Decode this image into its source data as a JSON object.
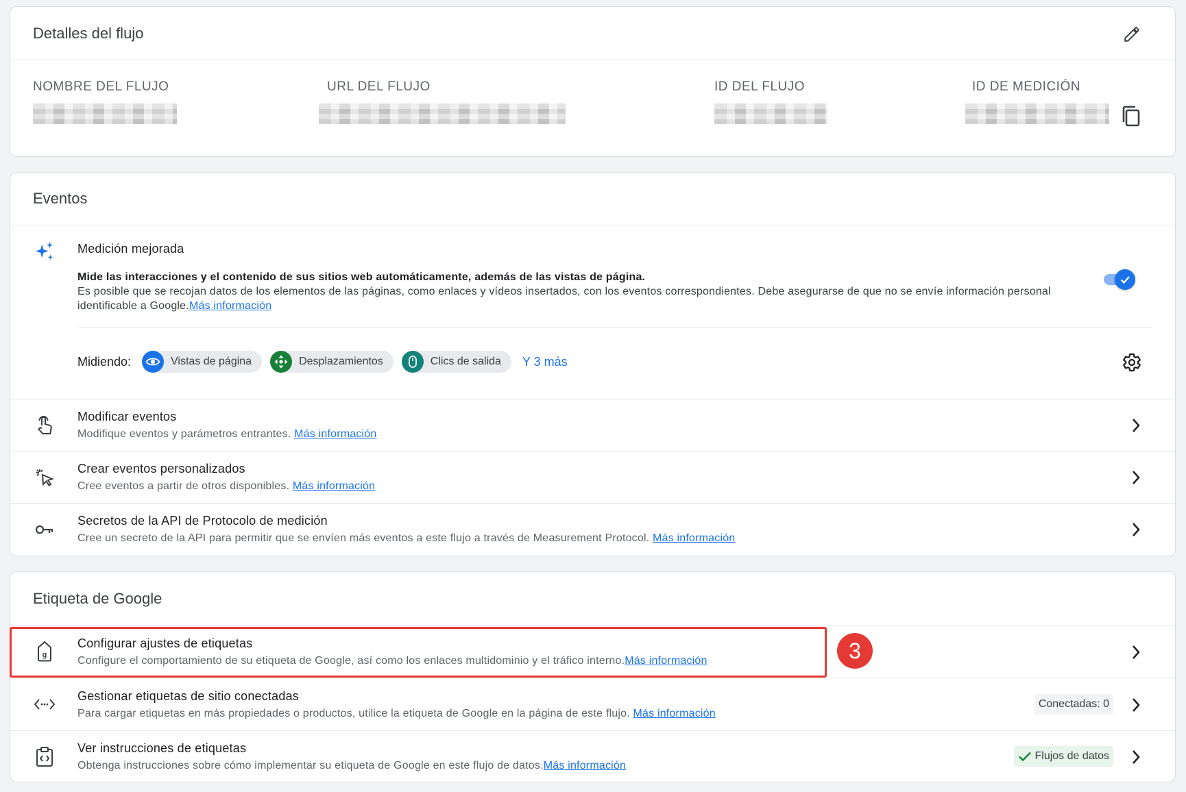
{
  "stream_details": {
    "title": "Detalles del flujo",
    "fields": [
      {
        "label": "NOMBRE DEL FLUJO"
      },
      {
        "label": "URL DEL FLUJO"
      },
      {
        "label": "ID DEL FLUJO"
      },
      {
        "label": "ID DE MEDICIÓN"
      }
    ]
  },
  "events": {
    "title": "Eventos",
    "enhanced": {
      "title": "Medición mejorada",
      "desc_bold": "Mide las interacciones y el contenido de sus sitios web automáticamente, además de las vistas de página.",
      "desc_rest": "Es posible que se recojan datos de los elementos de las páginas, como enlaces y vídeos insertados, con los eventos correspondientes. Debe asegurarse de que no se envíe información personal identificable a Google.",
      "link": "Más información",
      "toggle_on": true,
      "measuring_label": "Midiendo:",
      "chips": [
        {
          "label": "Vistas de página",
          "color": "#1a73e8"
        },
        {
          "label": "Desplazamientos",
          "color": "#188038"
        },
        {
          "label": "Clics de salida",
          "color": "#12827a"
        }
      ],
      "more": "Y 3 más"
    },
    "rows": [
      {
        "title": "Modificar eventos",
        "sub": "Modifique eventos y parámetros entrantes. ",
        "link": "Más información"
      },
      {
        "title": "Crear eventos personalizados",
        "sub": "Cree eventos a partir de otros disponibles. ",
        "link": "Más información"
      },
      {
        "title": "Secretos de la API de Protocolo de medición",
        "sub": "Cree un secreto de la API para permitir que se envíen más eventos a este flujo a través de Measurement Protocol. ",
        "link": "Más información"
      }
    ]
  },
  "google_tag": {
    "title": "Etiqueta de Google",
    "rows": [
      {
        "title": "Configurar ajustes de etiquetas",
        "sub": "Configure el comportamiento de su etiqueta de Google, así como los enlaces multidominio y el tráfico interno.",
        "link": "Más información"
      },
      {
        "title": "Gestionar etiquetas de sitio conectadas",
        "sub": "Para cargar etiquetas en más propiedades o productos, utilice la etiqueta de Google en la página de este flujo. ",
        "link": "Más información",
        "badge": "Conectadas: 0"
      },
      {
        "title": "Ver instrucciones de etiquetas",
        "sub": "Obtenga instrucciones sobre cómo implementar su etiqueta de Google en este flujo de datos.",
        "link": "Más información",
        "badge": "Flujos de datos"
      }
    ]
  },
  "annotation": {
    "step": "3",
    "color": "#e53935"
  },
  "colors": {
    "accent": "#1a73e8",
    "page_bg": "#f1f3f4"
  }
}
